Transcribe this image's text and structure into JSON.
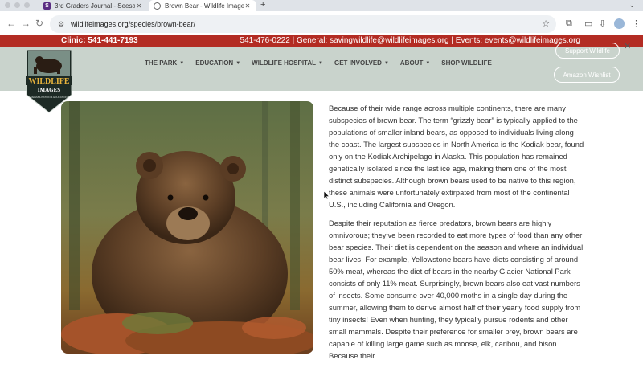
{
  "browser": {
    "tabs": [
      {
        "title": "3rd Graders Journal - Seesa",
        "favicon": "S"
      },
      {
        "title": "Brown Bear - Wildlife Images",
        "active": true
      }
    ],
    "url": "wildlifeimages.org/species/brown-bear/"
  },
  "site": {
    "topbar": {
      "clinic": "Clinic: 541-441-7193",
      "contacts": "541-476-0222 | General: savingwildlife@wildlifeimages.org | Events: events@wildlifeimages.org"
    },
    "logo": {
      "line1": "WILDLIFE",
      "line2": "IMAGES",
      "tagline": "REHABILITATION & EDUCATION"
    },
    "nav": [
      "THE PARK",
      "EDUCATION",
      "WILDLIFE HOSPITAL",
      "GET INVOLVED",
      "ABOUT",
      "SHOP WILDLIFE"
    ],
    "buttons": {
      "support": "Support Wildlife",
      "wishlist": "Amazon Wishlist"
    },
    "photo_alt": "brown-bear-photo",
    "paragraphs": [
      "Because of their wide range across multiple continents, there are many subspecies of brown bear. The term “grizzly bear” is typically applied to the populations of smaller inland bears, as opposed to individuals living along the coast. The largest subspecies in North America is the Kodiak bear, found only on the Kodiak Archipelago in Alaska. This population has remained genetically isolated since the last ice age, making them one of the most distinct subspecies. Although brown bears used to be native to this region, these animals were unfortunately extirpated from most of the continental U.S., including California and Oregon.",
      "Despite their reputation as fierce predators, brown bears are highly omnivorous; they’ve been recorded to eat more types of food than any other bear species. Their diet is dependent on the season and where an individual bear lives. For example, Yellowstone bears have diets consisting of around 50% meat, whereas the diet of bears in the nearby Glacier National Park consists of only 11% meat. Surprisingly, brown bears also eat vast numbers of insects. Some consume over 40,000 moths in a single day during the summer, allowing them to derive almost half of their yearly food supply from tiny insects! Even when hunting, they typically pursue rodents and other small mammals. Despite their preference for smaller prey, brown bears are capable of killing large game such as moose, elk, caribou, and bison. Because their"
    ]
  },
  "colors": {
    "topbar": "#b32c23",
    "header": "#c9d3cc",
    "nav_text": "#444444"
  }
}
